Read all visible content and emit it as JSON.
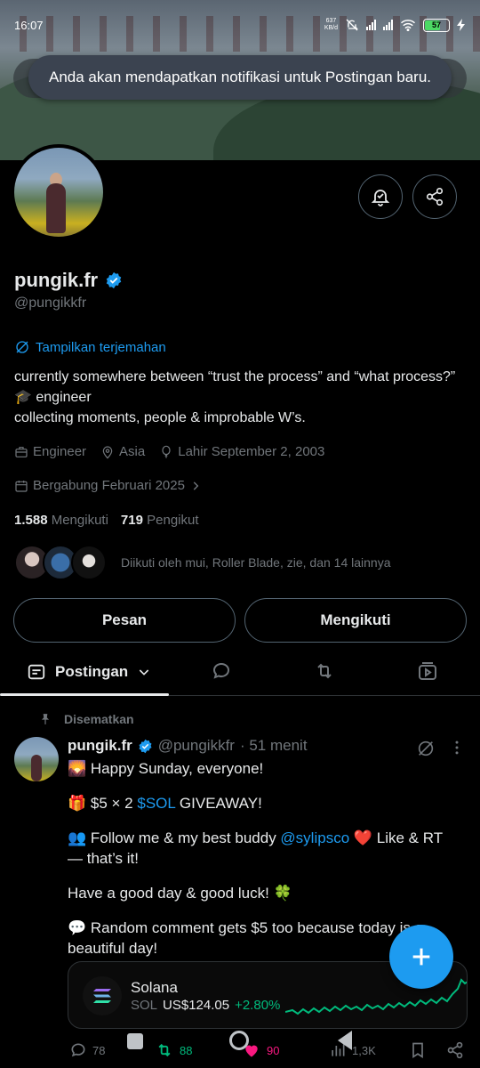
{
  "status_bar": {
    "time": "16:07",
    "net_speed_value": "637",
    "net_speed_unit": "KB/d",
    "battery": "57"
  },
  "toast": {
    "message": "Anda akan mendapatkan notifikasi untuk Postingan baru."
  },
  "profile": {
    "name": "pungik.fr",
    "handle": "@pungikkfr",
    "translate_label": "Tampilkan terjemahan",
    "bio_line1": "currently somewhere between “trust the process” and “what process?”",
    "bio_line2": "🎓 engineer",
    "bio_line3": "collecting moments, people & improbable W’s.",
    "profession": "Engineer",
    "location": "Asia",
    "birthday": "Lahir September 2, 2003",
    "joined": "Bergabung Februari 2025",
    "following_count": "1.588",
    "following_label": "Mengikuti",
    "followers_count": "719",
    "followers_label": "Pengikut",
    "followed_by": "Diikuti oleh mui, Roller Blade, zie, dan 14 lainnya"
  },
  "buttons": {
    "message": "Pesan",
    "following": "Mengikuti"
  },
  "tabs": {
    "posts": "Postingan"
  },
  "post": {
    "pinned_label": "Disematkan",
    "author_name": "pungik.fr",
    "author_handle": "@pungikkfr",
    "time": "· 51 menit",
    "line1": "🌄 Happy Sunday, everyone!",
    "line2_pre": "🎁 $5 × 2 ",
    "line2_tag": "$SOL",
    "line2_post": " GIVEAWAY!",
    "line3_pre": "👥 Follow me & my best buddy ",
    "line3_mention": "@sylipsco",
    "line3_post": " ❤️ Like & RT — that’s it!",
    "line4": "Have a good day & good luck! 🍀",
    "line5": "💬 Random comment gets $5 too because today is a beautiful day!",
    "card": {
      "title": "Solana",
      "ticker": "SOL",
      "price": "US$124.05",
      "change": "+2.80%"
    },
    "replies": "78",
    "reposts": "88",
    "likes": "90",
    "views": "1,3K"
  },
  "colors": {
    "accent": "#1d9bf0",
    "positive": "#00ba7c",
    "like": "#f91880",
    "muted": "#71767b"
  }
}
